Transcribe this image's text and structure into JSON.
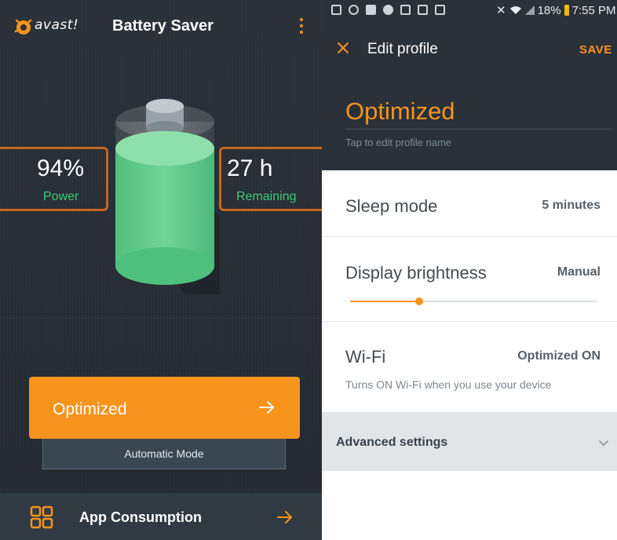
{
  "left_screen": {
    "brand": "avast!",
    "title": "Battery Saver",
    "power_value": "94%",
    "power_label": "Power",
    "remaining_value": "27 h",
    "remaining_label": "Remaining",
    "mode_button": "Optimized",
    "mode_caption": "Automatic Mode",
    "app_consumption": "App Consumption",
    "battery_level_fraction": 0.94
  },
  "right_screen": {
    "status_bar": {
      "battery": "18%",
      "time": "7:55 PM"
    },
    "header": {
      "title": "Edit profile",
      "save": "SAVE"
    },
    "profile": {
      "name": "Optimized",
      "hint": "Tap to edit profile name"
    },
    "settings": [
      {
        "name": "Sleep mode",
        "value": "5 minutes"
      },
      {
        "name": "Display brightness",
        "value": "Manual",
        "slider_fraction": 0.28
      },
      {
        "name": "Wi-Fi",
        "value": "Optimized ON",
        "description": "Turns ON Wi-Fi when you use your device"
      }
    ],
    "advanced": "Advanced settings"
  },
  "colors": {
    "accent": "#f7941d",
    "battery_green": "#3ecb78",
    "dark_bg": "#2a3139"
  }
}
